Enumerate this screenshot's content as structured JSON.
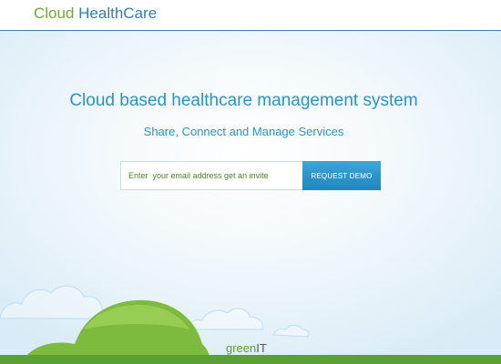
{
  "header": {
    "logo_word1": "Cloud",
    "logo_word2": "HealthCare"
  },
  "hero": {
    "headline": "Cloud based healthcare management system",
    "subline": "Share, Connect and Manage Services"
  },
  "signup": {
    "email_placeholder": "Enter  your email address get an invite",
    "button_label": "REQUEST DEMO"
  },
  "footer": {
    "brand_part1": "green",
    "brand_part2": "IT"
  },
  "colors": {
    "brand_green": "#6eab2f",
    "brand_blue": "#2f7fba",
    "accent_button": "#2a93c9",
    "grass": "#5aa033"
  }
}
